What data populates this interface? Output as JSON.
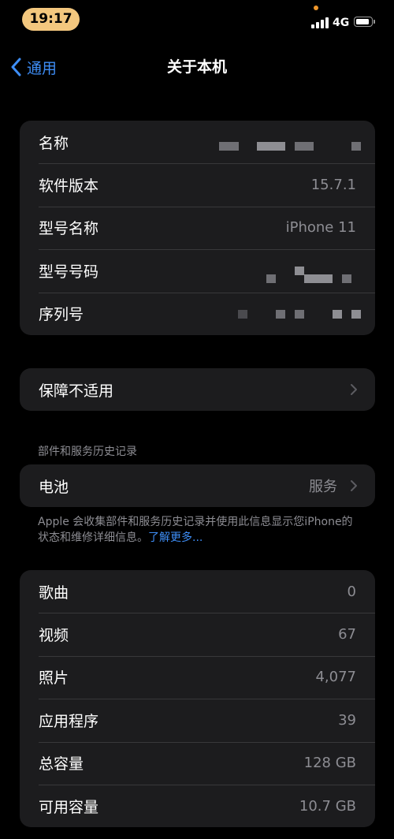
{
  "status_bar": {
    "time": "19:17",
    "network": "4G"
  },
  "nav": {
    "back_label": "通用",
    "title": "关于本机"
  },
  "device_info": {
    "rows": [
      {
        "label": "名称",
        "value": ""
      },
      {
        "label": "软件版本",
        "value": "15.7.1"
      },
      {
        "label": "型号名称",
        "value": "iPhone 11"
      },
      {
        "label": "型号号码",
        "value": ""
      },
      {
        "label": "序列号",
        "value": ""
      }
    ]
  },
  "warranty": {
    "label": "保障不适用"
  },
  "parts_history": {
    "header": "部件和服务历史记录",
    "battery_label": "电池",
    "battery_value": "服务",
    "footnote": "Apple 会收集部件和服务历史记录并使用此信息显示您iPhone的状态和维修详细信息。",
    "footnote_link": "了解更多..."
  },
  "media": {
    "rows": [
      {
        "label": "歌曲",
        "value": "0"
      },
      {
        "label": "视频",
        "value": "67"
      },
      {
        "label": "照片",
        "value": "4,077"
      },
      {
        "label": "应用程序",
        "value": "39"
      },
      {
        "label": "总容量",
        "value": "128 GB"
      },
      {
        "label": "可用容量",
        "value": "10.7 GB"
      }
    ]
  },
  "colors": {
    "accent": "#3e8ef7",
    "cell_bg": "#1c1c1e",
    "time_pill": "#f3c77e",
    "secondary_text": "#8d8d93"
  },
  "icons": {
    "back": "chevron-left-icon",
    "disclosure": "chevron-right-icon",
    "signal": "signal-icon",
    "battery": "battery-icon"
  }
}
